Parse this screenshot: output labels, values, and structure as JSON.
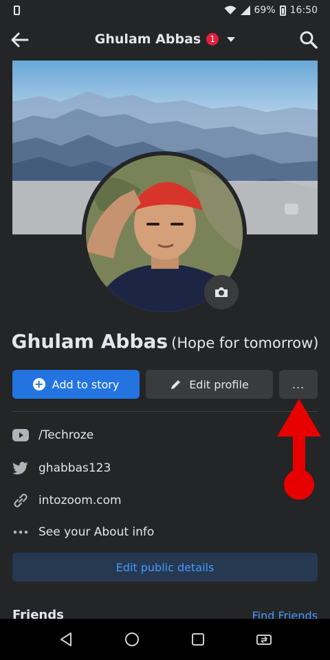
{
  "status_bar": {
    "battery_percent": "69%",
    "time": "16:50"
  },
  "app_bar": {
    "title": "Ghulam Abbas",
    "notification_count": "1"
  },
  "profile": {
    "name": "Ghulam Abbas",
    "nickname": "(Hope for tomorrow)"
  },
  "actions": {
    "add_story": "Add to story",
    "edit_profile": "Edit profile",
    "more": "..."
  },
  "info": [
    {
      "icon": "youtube-icon",
      "text": "/Techroze"
    },
    {
      "icon": "twitter-icon",
      "text": "ghabbas123"
    },
    {
      "icon": "link-icon",
      "text": "intozoom.com"
    },
    {
      "icon": "more-dots-icon",
      "text": "See your About info"
    }
  ],
  "edit_public_details": "Edit public details",
  "friends_peek": "Friends",
  "find_friends_peek": "Find Friends",
  "colors": {
    "background": "#242526",
    "primary": "#2374e1",
    "button_secondary": "#3a3b3c",
    "annotation_arrow": "#e60000"
  }
}
